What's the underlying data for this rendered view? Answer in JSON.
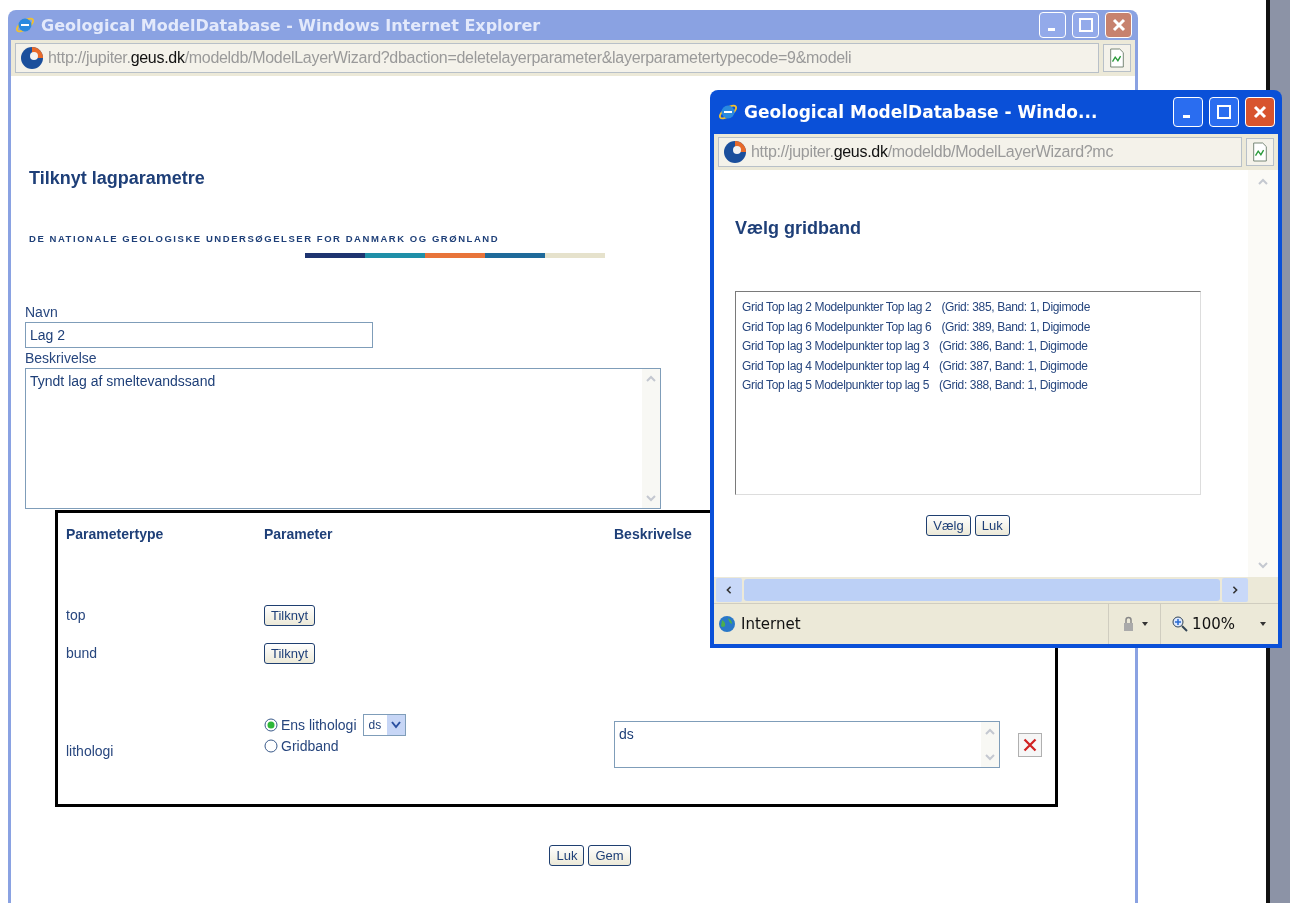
{
  "main_window": {
    "title": "Geological ModelDatabase - Windows Internet Explorer",
    "address": {
      "prefix": "http://jupiter.",
      "host": "geus.dk",
      "path": "/modeldb/ModelLayerWizard?dbaction=deletelayerparameter&layerparametertypecode=9&modeli"
    },
    "heading": "Tilknyt lagparametre",
    "org_name": "DE NATIONALE GEOLOGISKE UNDERSØGELSER FOR DANMARK OG GRØNLAND",
    "form": {
      "name_label": "Navn",
      "name_value": "Lag 2",
      "description_label": "Beskrivelse",
      "description_value": "Tyndt lag af smeltevandssand"
    },
    "parameters": {
      "columns": [
        "Parametertype",
        "Parameter",
        "Beskrivelse"
      ],
      "rows": [
        {
          "type": "top",
          "kind": "button",
          "button": "Tilknyt"
        },
        {
          "type": "bund",
          "kind": "button",
          "button": "Tilknyt"
        },
        {
          "type": "lithologi",
          "kind": "choice",
          "options": [
            {
              "label": "Ens lithologi",
              "selected": true,
              "select_value": "ds"
            },
            {
              "label": "Gridband",
              "selected": false
            }
          ],
          "description": "ds"
        }
      ]
    },
    "buttons": [
      "Luk",
      "Gem"
    ]
  },
  "popup_window": {
    "title": "Geological ModelDatabase - Windo...",
    "address": {
      "prefix": "http://jupiter.",
      "host": "geus.dk",
      "path": "/modeldb/ModelLayerWizard?mc"
    },
    "heading": "Vælg gridband",
    "items": [
      {
        "name": "Grid Top lag 2 Modelpunkter Top lag 2",
        "info": "(Grid: 385, Band: 1, Digimode"
      },
      {
        "name": "Grid Top lag 6 Modelpunkter Top lag 6",
        "info": "(Grid: 389, Band: 1, Digimode"
      },
      {
        "name": "Grid Top lag 3 Modelpunkter top lag 3",
        "info": "(Grid: 386, Band: 1, Digimode"
      },
      {
        "name": "Grid Top lag 4 Modelpunkter top lag 4",
        "info": "(Grid: 387, Band: 1, Digimode"
      },
      {
        "name": "Grid Top lag 5 Modelpunkter top lag 5",
        "info": "(Grid: 388, Band: 1, Digimode"
      }
    ],
    "buttons": [
      "Vælg",
      "Luk"
    ],
    "status": {
      "zone": "Internet",
      "zoom": "100%"
    }
  }
}
